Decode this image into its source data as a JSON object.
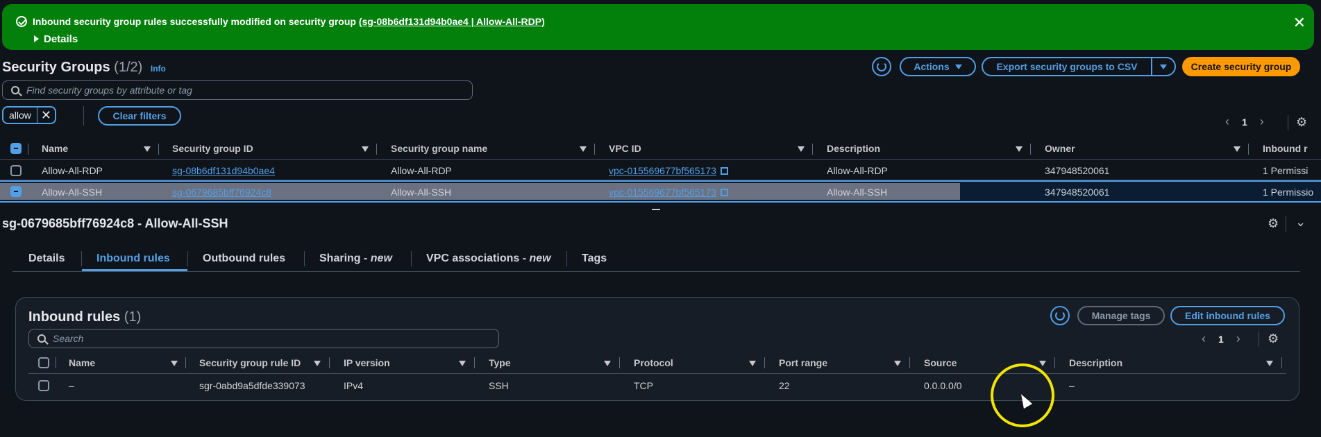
{
  "flash": {
    "message_prefix": "Inbound security group rules successfully modified on security group",
    "message_link": "(sg-08b6df131d94b0ae4 | Allow-All-RDP)",
    "details_label": "Details",
    "close_icon": "close-icon"
  },
  "header": {
    "title": "Security Groups",
    "count": "(1/2)",
    "info": "Info",
    "actions": "Actions",
    "export": "Export security groups to CSV",
    "create": "Create security group"
  },
  "search": {
    "placeholder": "Find security groups by attribute or tag"
  },
  "filter": {
    "token": "allow",
    "clear": "Clear filters"
  },
  "pagination": {
    "page": "1",
    "prev": "‹",
    "next": "›"
  },
  "table": {
    "headers": {
      "name": "Name",
      "sgid": "Security group ID",
      "sgname": "Security group name",
      "vpc": "VPC ID",
      "desc": "Description",
      "owner": "Owner",
      "inbound": "Inbound r"
    },
    "rows": [
      {
        "name": "Allow-All-RDP",
        "sgid": "sg-08b6df131d94b0ae4",
        "sgname": "Allow-All-RDP",
        "vpc": "vpc-015569677bf565173",
        "desc": "Allow-All-RDP",
        "owner": "347948520061",
        "inbound": "1 Permissi"
      },
      {
        "name": "Allow-All-SSH",
        "sgid": "sg-0679685bff76924c8",
        "sgname": "Allow-All-SSH",
        "vpc": "vpc-015569677bf565173",
        "desc": "Allow-All-SSH",
        "owner": "347948520061",
        "inbound": "1 Permissio"
      }
    ]
  },
  "detail": {
    "title": "sg-0679685bff76924c8 - Allow-All-SSH",
    "tabs": [
      {
        "label": "Details"
      },
      {
        "label": "Inbound rules"
      },
      {
        "label": "Outbound rules"
      },
      {
        "label": "Sharing - ",
        "tag": "new"
      },
      {
        "label": "VPC associations - ",
        "tag": "new"
      },
      {
        "label": "Tags"
      }
    ]
  },
  "inbound": {
    "title": "Inbound rules",
    "count": "(1)",
    "manage_tags": "Manage tags",
    "edit": "Edit inbound rules",
    "search_placeholder": "Search",
    "page": "1",
    "headers": {
      "name": "Name",
      "ruleid": "Security group rule ID",
      "ipver": "IP version",
      "type": "Type",
      "protocol": "Protocol",
      "port": "Port range",
      "source": "Source",
      "desc": "Description"
    },
    "rows": [
      {
        "name": "–",
        "ruleid": "sgr-0abd9a5dfde339073",
        "ipver": "IPv4",
        "type": "SSH",
        "protocol": "TCP",
        "port": "22",
        "source": "0.0.0.0/0",
        "desc": "–"
      }
    ]
  },
  "colors": {
    "success": "#037f0c",
    "accent": "#539fe5",
    "primary": "#ff9900",
    "background": "#0f141a"
  }
}
